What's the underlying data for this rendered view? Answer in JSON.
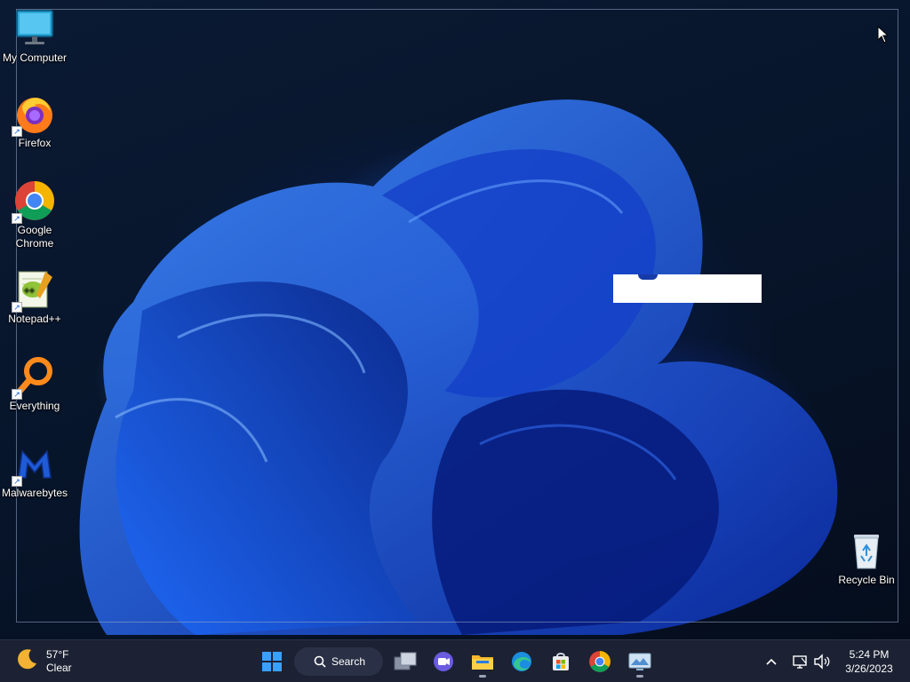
{
  "desktop": {
    "icons": [
      {
        "label": "My Computer"
      },
      {
        "label": "Firefox"
      },
      {
        "label": "Google Chrome"
      },
      {
        "label": "Notepad++"
      },
      {
        "label": "Everything"
      },
      {
        "label": "Malwarebytes"
      },
      {
        "label": "Recycle Bin"
      }
    ]
  },
  "taskbar": {
    "weather": {
      "temperature": "57°F",
      "condition": "Clear",
      "icon": "moon-icon"
    },
    "search_label": "Search",
    "pinned": [
      {
        "name": "start",
        "icon": "windows-logo-icon"
      },
      {
        "name": "search",
        "icon": "search-icon"
      },
      {
        "name": "task-view",
        "icon": "task-view-icon"
      },
      {
        "name": "chat",
        "icon": "chat-icon"
      },
      {
        "name": "file-explorer",
        "icon": "folder-icon",
        "running": true
      },
      {
        "name": "edge",
        "icon": "edge-icon"
      },
      {
        "name": "store",
        "icon": "store-icon"
      },
      {
        "name": "chrome",
        "icon": "chrome-icon"
      },
      {
        "name": "photos",
        "icon": "photos-icon",
        "running": true
      }
    ],
    "tray": {
      "icons": [
        "chevron-up-icon",
        "network-icon",
        "volume-icon"
      ]
    },
    "clock": {
      "time": "5:24 PM",
      "date": "3/26/2023"
    }
  },
  "colors": {
    "taskbar": "#1c2233",
    "accent": "#0a5ad8"
  }
}
